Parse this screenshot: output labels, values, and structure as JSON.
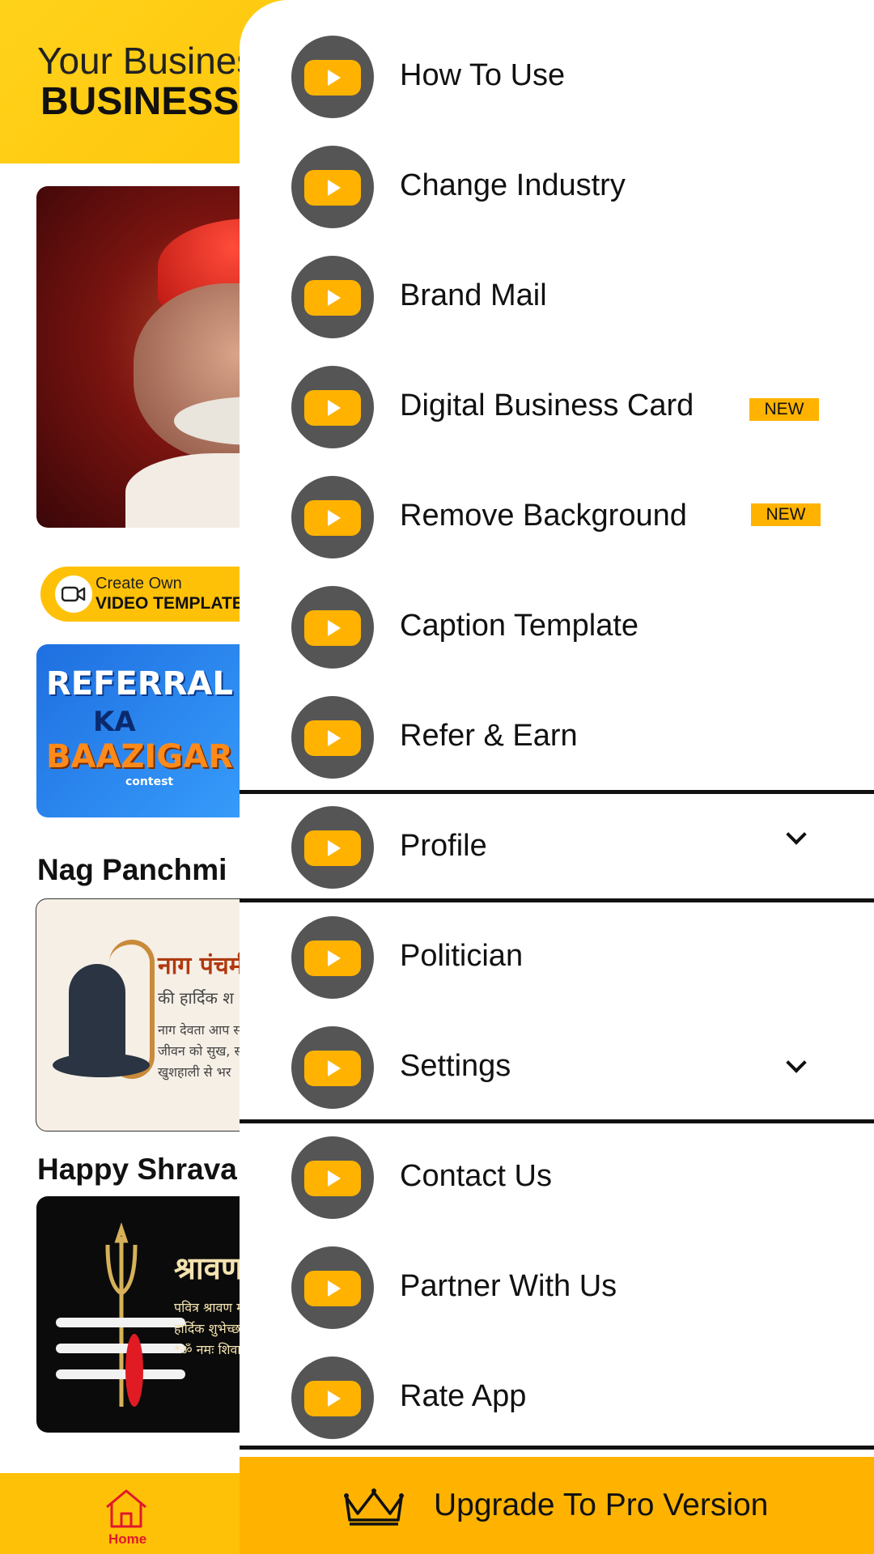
{
  "background": {
    "header": {
      "title_line1": "Your Busines",
      "title_line2": "BUSINESS"
    },
    "video_template_pill": {
      "line1": "Create Own",
      "line2": "VIDEO TEMPLATE"
    },
    "referral_banner": {
      "line1": "REFERRAL",
      "line2": "KA",
      "line3": "BAAZIGAR",
      "line4": "contest"
    },
    "sections": [
      {
        "title": "Nag Panchmi"
      },
      {
        "title": "Happy Shrava"
      }
    ],
    "nag_card": {
      "t1": "नाग पंचमी",
      "t2": "की हार्दिक श",
      "t3": "नाग देवता आप स",
      "t4": "जीवन को सुख, समृ",
      "t5": "खुशहाली से भर"
    },
    "shravan_card": {
      "t1": "श्रावण म",
      "t2": "पवित्र श्रावण मा",
      "t3": "हार्दिक शुभेच्छ",
      "t4": "*ॐ नमः शिवा"
    },
    "bottom_nav": {
      "home_label": "Home"
    }
  },
  "drawer": {
    "items": [
      {
        "label": "How To Use"
      },
      {
        "label": "Change Industry"
      },
      {
        "label": "Brand Mail"
      },
      {
        "label": "Digital Business Card",
        "badge": "NEW"
      },
      {
        "label": "Remove Background",
        "badge": "NEW"
      },
      {
        "label": "Caption Template"
      },
      {
        "label": "Refer & Earn"
      },
      {
        "label": "Profile"
      },
      {
        "label": "Politician"
      },
      {
        "label": "Settings"
      },
      {
        "label": "Contact Us"
      },
      {
        "label": "Partner With Us"
      },
      {
        "label": "Rate App"
      }
    ],
    "upgrade_label": "Upgrade To Pro Version"
  },
  "colors": {
    "accent": "#ffb300",
    "header_yellow": "#ffc107",
    "play_circle": "#555555",
    "home_active": "#e0182d"
  }
}
